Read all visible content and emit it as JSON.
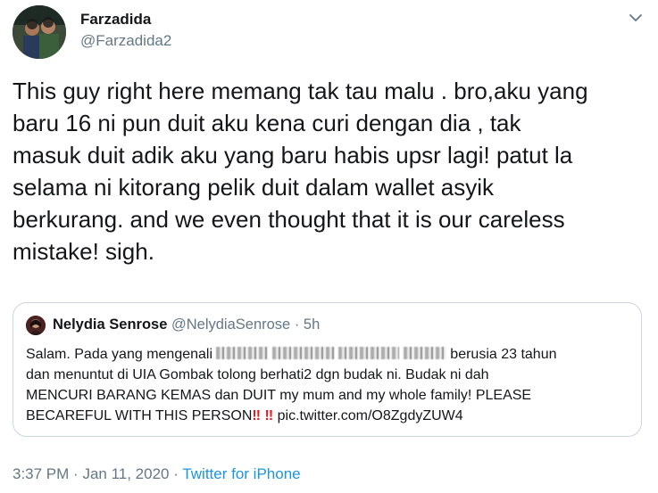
{
  "author": {
    "name": "Farzadida",
    "handle": "@Farzadida2"
  },
  "tweet": {
    "lines": [
      "This guy right here memang tak tau malu . bro,aku yang",
      "baru 16 ni pun duit aku kena curi dengan dia , tak",
      "masuk duit adik aku yang baru habis upsr lagi! patut la",
      "selama ni kitorang pelik duit dalam wallet asyik",
      "berkurang. and we even thought that it is our careless",
      "mistake! sigh."
    ]
  },
  "quoted": {
    "name": "Nelydia Senrose",
    "handle": "@NelydiaSenrose",
    "separator": "·",
    "time": "5h",
    "line1_before": "Salam. Pada yang mengenali",
    "line1_after": "berusia 23 tahun",
    "line2": "dan menuntut di UIA Gombak tolong berhati2 dgn budak ni. Budak ni dah",
    "line3": "MENCURI BARANG KEMAS dan DUIT my mum and my whole family! PLEASE",
    "line4_before": "BECAREFUL WITH THIS PERSON",
    "emoji_1": "‼",
    "emoji_2": "‼",
    "link": "pic.twitter.com/O8ZgdyZUW4"
  },
  "footer": {
    "time": "3:37 PM",
    "separator1": "·",
    "date": "Jan 11, 2020",
    "separator2": "·",
    "source": "Twitter for iPhone"
  },
  "icons": {
    "caret": "chevron-down-icon"
  },
  "colors": {
    "text": "#14171a",
    "secondary": "#657786",
    "link": "#1b95e0",
    "border": "#ccd6dd"
  }
}
